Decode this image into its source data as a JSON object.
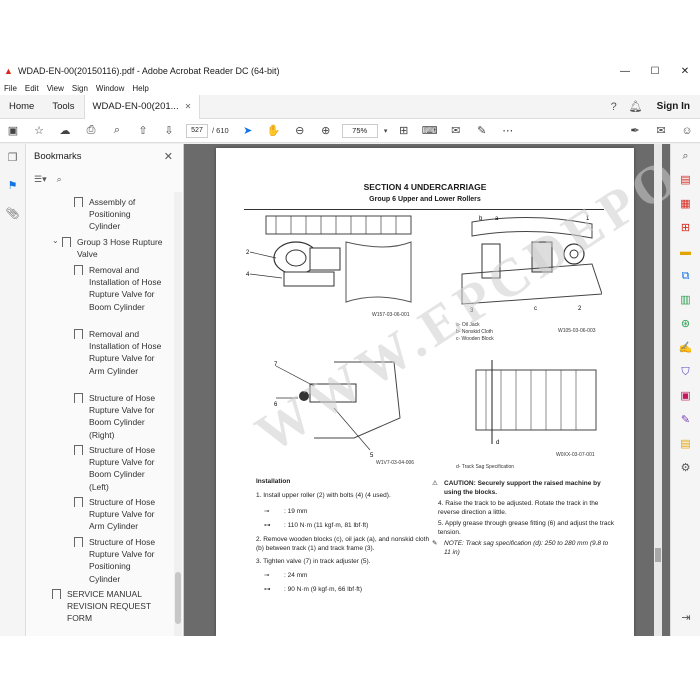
{
  "window": {
    "title": "WDAD-EN-00(20150116).pdf - Adobe Acrobat Reader DC (64-bit)",
    "minimize": "—",
    "maximize": "☐",
    "close": "✕"
  },
  "menu": [
    "File",
    "Edit",
    "View",
    "Sign",
    "Window",
    "Help"
  ],
  "tabs": {
    "home": "Home",
    "tools": "Tools",
    "doc": "WDAD-EN-00(201...",
    "doc_close": "✕",
    "signin": "Sign In"
  },
  "toolbar": {
    "page_current": "527",
    "page_total": "/ 610",
    "zoom": "75%"
  },
  "bookmarks": {
    "title": "Bookmarks",
    "items": [
      {
        "label": "Assembly of Positioning Cylinder"
      },
      {
        "label": "Group 3 Hose Rupture Valve"
      },
      {
        "label": "Removal and Installation of Hose Rupture Valve for Boom Cylinder"
      },
      {
        "label": "Removal and Installation of Hose Rupture Valve for Arm Cylinder"
      },
      {
        "label": "Structure of Hose Rupture Valve for Boom Cylinder (Right)"
      },
      {
        "label": "Structure of Hose Rupture Valve for Boom Cylinder (Left)"
      },
      {
        "label": "Structure of Hose Rupture Valve for Arm Cylinder"
      },
      {
        "label": "Structure of Hose Rupture Valve for Positioning Cylinder"
      },
      {
        "label": "SERVICE MANUAL REVISION REQUEST FORM"
      }
    ]
  },
  "document": {
    "section_title": "SECTION 4 UNDERCARRIAGE",
    "group_title": "Group 6 Upper and Lower Rollers",
    "fig1_code": "W157-03-06-001",
    "fig2_code": "W105-03-06-003",
    "fig3_code": "W1V7-03-04-006",
    "fig4_code": "W0XX-03-07-001",
    "legend_a": "a-     Oil Jack",
    "legend_b": "b-     Nonskid Cloth",
    "legend_c": "c-     Wooden Block",
    "legend_d": "d-     Track Sag Specification",
    "installation_heading": "Installation",
    "step1": "1.  Install upper roller (2) with bolts (4) (4 used).",
    "step1_tool": ": 19 mm",
    "step1_torque": ": 110 N·m (11 kgf·m, 81 lbf·ft)",
    "step2": "2.  Remove wooden blocks (c), oil jack (a), and nonskid cloth (b) between track (1) and track frame (3).",
    "step3": "3.  Tighten valve (7) in track adjuster (5).",
    "step3_tool": ": 24 mm",
    "step3_torque": ": 90 N·m (9 kgf·m, 66 lbf·ft)",
    "caution": "CAUTION:   Securely support the raised machine by using the blocks.",
    "step4": "4.  Raise the track to be adjusted. Rotate the track in the reverse direction a little.",
    "step5": "5.  Apply grease through grease fitting (6) and adjust the track tension.",
    "note": "NOTE:   Track sag specification (d): 250 to 280 mm (9.8 to 11 in)",
    "watermark": "WWW.EPCDEPO.COM"
  }
}
